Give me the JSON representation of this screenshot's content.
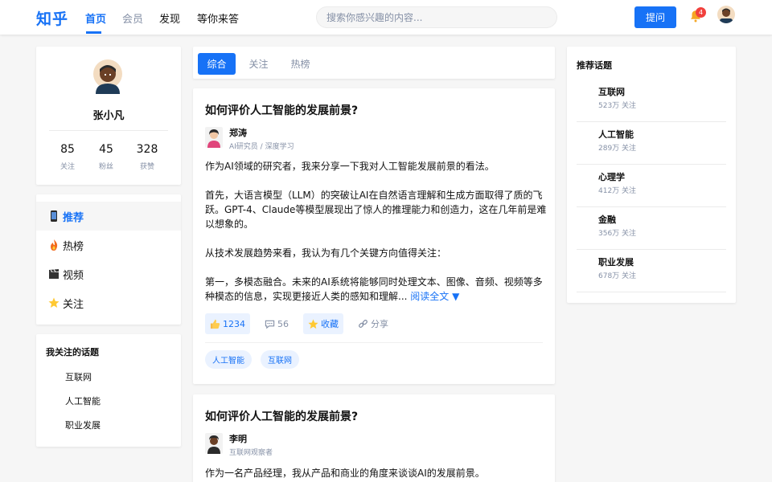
{
  "header": {
    "logo": "知乎",
    "nav": [
      "首页",
      "会员",
      "发现",
      "等你来答"
    ],
    "search_placeholder": "搜索你感兴趣的内容...",
    "ask_label": "提问",
    "notification_count": "4"
  },
  "profile": {
    "name": "张小凡",
    "stats": [
      {
        "value": "85",
        "label": "关注"
      },
      {
        "value": "45",
        "label": "粉丝"
      },
      {
        "value": "328",
        "label": "获赞"
      }
    ]
  },
  "menu": [
    {
      "label": "推荐",
      "icon": "phone-icon"
    },
    {
      "label": "热榜",
      "icon": "fire-icon"
    },
    {
      "label": "视频",
      "icon": "clapper-icon"
    },
    {
      "label": "关注",
      "icon": "star-icon"
    }
  ],
  "followed_topics": {
    "title": "我关注的话题",
    "items": [
      "互联网",
      "人工智能",
      "职业发展"
    ]
  },
  "tabs": [
    "综合",
    "关注",
    "热榜"
  ],
  "feed": [
    {
      "title": "如何评价人工智能的发展前景?",
      "author": "郑涛",
      "bio": "AI研究员 / 深度学习",
      "paragraphs": [
        "作为AI领域的研究者，我来分享一下我对人工智能发展前景的看法。",
        "首先，大语言模型（LLM）的突破让AI在自然语言理解和生成方面取得了质的飞跃。GPT-4、Claude等模型展现出了惊人的推理能力和创造力，这在几年前是难以想象的。",
        "从技术发展趋势来看，我认为有几个关键方向值得关注：",
        "第一，多模态融合。未来的AI系统将能够同时处理文本、图像、音频、视频等多种模态的信息，实现更接近人类的感知和理解..."
      ],
      "read_more": "阅读全文 ▼",
      "likes": "1234",
      "comments": "56",
      "collect": "收藏",
      "share": "分享",
      "tags": [
        "人工智能",
        "互联网"
      ]
    },
    {
      "title": "如何评价人工智能的发展前景?",
      "author": "李明",
      "bio": "互联网观察者",
      "paragraphs": [
        "作为一名产品经理，我从产品和商业的角度来谈谈AI的发展前景。"
      ]
    }
  ],
  "recommended": {
    "title": "推荐话题",
    "items": [
      {
        "name": "互联网",
        "count": "523万 关注"
      },
      {
        "name": "人工智能",
        "count": "289万 关注"
      },
      {
        "name": "心理学",
        "count": "412万 关注"
      },
      {
        "name": "金融",
        "count": "356万 关注"
      },
      {
        "name": "职业发展",
        "count": "678万 关注"
      }
    ]
  },
  "colors": {
    "accent": "#1772f6",
    "badge": "#f1403c",
    "muted": "#8590a6"
  }
}
